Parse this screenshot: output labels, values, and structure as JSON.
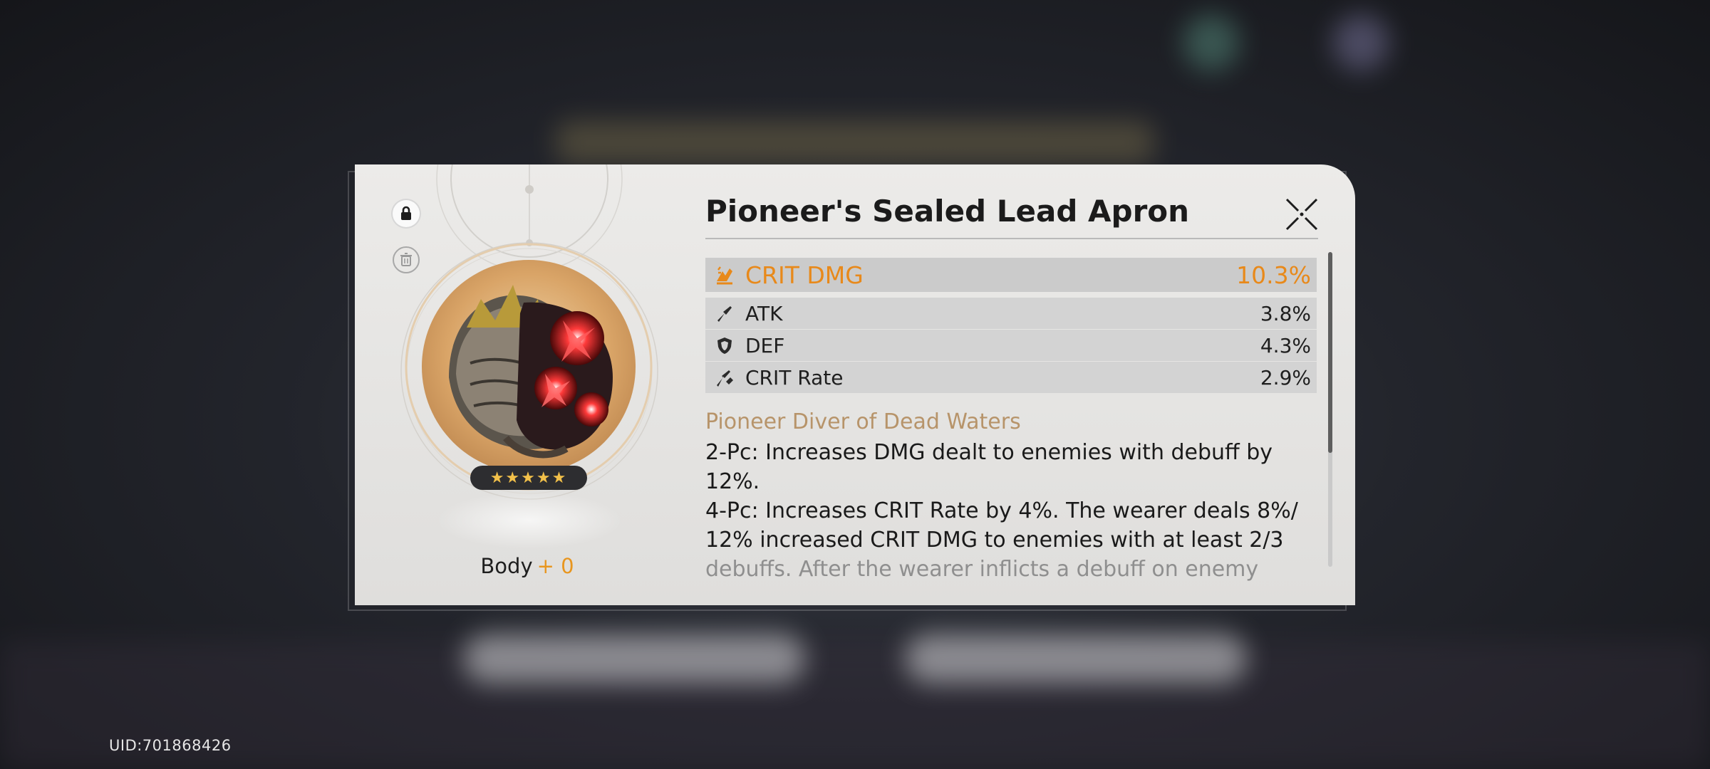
{
  "uid": "UID:701868426",
  "relic": {
    "name": "Pioneer's Sealed Lead Apron",
    "piece": "Body",
    "level": "+ 0",
    "stars": "★★★★★",
    "main_stat": {
      "name": "CRIT DMG",
      "value": "10.3%",
      "icon": "crit-dmg-icon"
    },
    "sub_stats": [
      {
        "name": "ATK",
        "value": "3.8%",
        "icon": "atk-icon"
      },
      {
        "name": "DEF",
        "value": "4.3%",
        "icon": "def-icon"
      },
      {
        "name": "CRIT Rate",
        "value": "2.9%",
        "icon": "crit-rate-icon"
      }
    ],
    "set_name": "Pioneer Diver of Dead Waters",
    "set_2pc": "2-Pc: Increases DMG dealt to enemies with debuff by 12%.",
    "set_4pc": "4-Pc: Increases CRIT Rate by 4%. The wearer deals 8%/ 12% increased CRIT DMG to enemies with at least 2/3",
    "set_4pc_fade": "debuffs. After the wearer inflicts a debuff on enemy"
  },
  "colors": {
    "accent": "#e8891a",
    "set_name": "#b7946a",
    "panel": "#e6e5e3"
  }
}
